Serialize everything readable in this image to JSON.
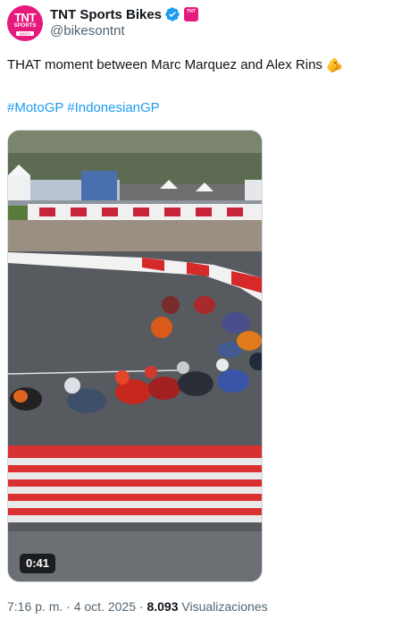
{
  "author": {
    "avatar_text_main": "TNT",
    "avatar_text_sub": "SPORTS",
    "avatar_text_small": "BIKES",
    "display_name": "TNT Sports Bikes",
    "handle": "@bikesontnt",
    "affiliate_badge_text": "TNT"
  },
  "tweet": {
    "text": "THAT moment between Marc Marquez and Alex Rins",
    "emoji": "🫵",
    "hashtags": [
      "#MotoGP",
      "#IndonesianGP"
    ]
  },
  "media": {
    "duration": "0:41"
  },
  "meta": {
    "time": "7:16 p. m.",
    "separator": "·",
    "date": "4 oct. 2025",
    "views_count": "8.093",
    "views_label": "Visualizaciones"
  },
  "colors": {
    "accent": "#1d9bf0",
    "brand": "#e6197d",
    "text": "#0f1419",
    "muted": "#536471"
  }
}
